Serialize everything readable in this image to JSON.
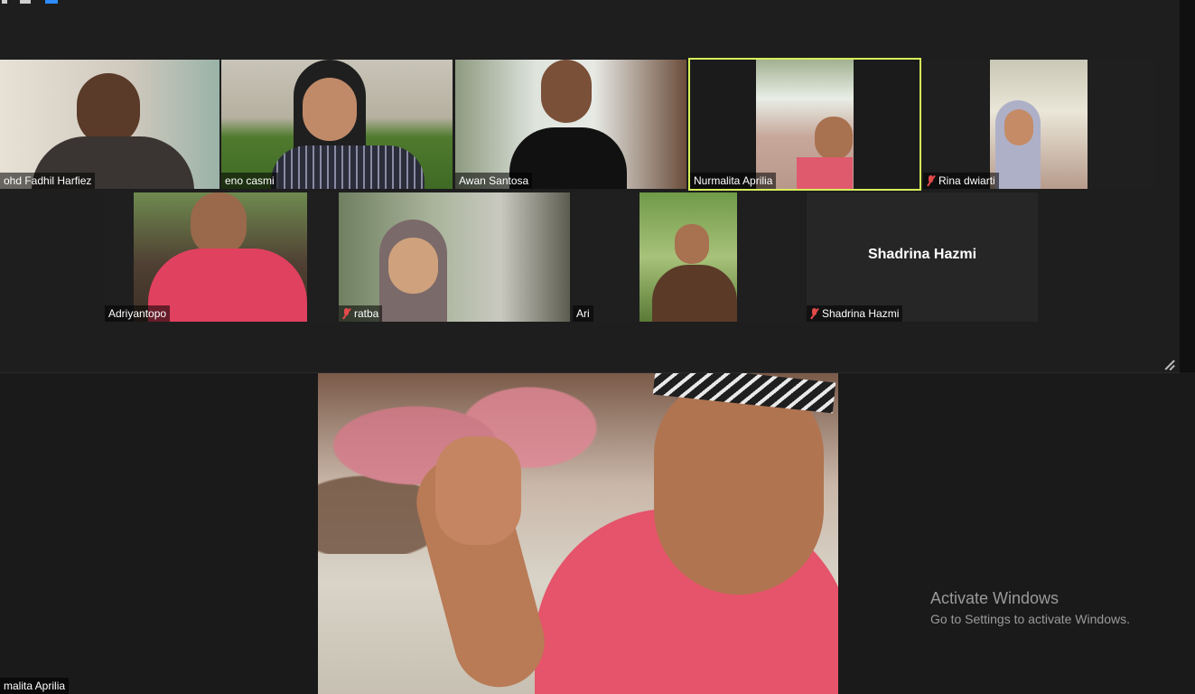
{
  "gallery": {
    "participants": [
      {
        "name": "Mohd Fadhil Harfiez",
        "shown_name": "ohd Fadhil Harfiez",
        "muted": false
      },
      {
        "name": "eno casmi",
        "muted": false
      },
      {
        "name": "Awan Santosa",
        "muted": false
      },
      {
        "name": "Nurmalita Aprilia",
        "muted": false,
        "active_speaker": true
      },
      {
        "name": "Rina dwiarti",
        "muted": true
      },
      {
        "name": "Adriyantopo",
        "muted": false
      },
      {
        "name": "ratba",
        "muted": true
      },
      {
        "name": "Ari",
        "muted": false
      },
      {
        "name": "Shadrina Hazmi",
        "muted": true,
        "video_off": true
      }
    ]
  },
  "main": {
    "speaker_name_shown": "malita Aprilia"
  },
  "watermark": {
    "title": "Activate Windows",
    "subtitle": "Go to Settings to activate Windows."
  },
  "colors": {
    "background": "#1a1a1a",
    "panel": "#1e1e1e",
    "active_speaker_border": "#d7f05a",
    "muted_icon": "#e24a4a",
    "accent": "#2d8cff"
  },
  "icons": [
    "mic-muted-icon",
    "resize-grip-icon",
    "toolbar-icons"
  ]
}
